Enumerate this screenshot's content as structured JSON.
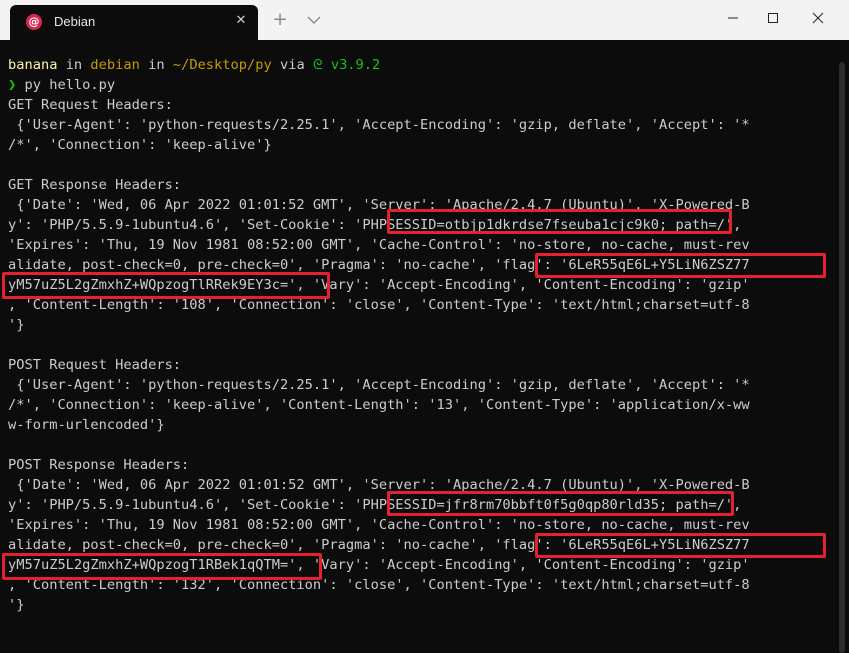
{
  "window": {
    "tab_title": "Debian",
    "tab_icon": "debian-swirl-icon",
    "close_tab": "✕",
    "new_tab": "+",
    "minimize": "—",
    "maximize": "☐",
    "close": "✕"
  },
  "colors": {
    "highlight": "#e3212f",
    "prompt_user": "#f9f1a5",
    "prompt_dir": "#c19c00",
    "prompt_py": "#16c60c"
  },
  "prompt": {
    "user": "banana",
    "in1": " in ",
    "host": "debian",
    "in2": " in ",
    "path": "~/Desktop/py",
    "via": " via ",
    "py_icon": "python-snake-icon",
    "version": "v3.9.2",
    "arrow": "❯",
    "command": " py hello.py"
  },
  "output": [
    "GET Request Headers:",
    " {'User-Agent': 'python-requests/2.25.1', 'Accept-Encoding': 'gzip, deflate', 'Accept': '*",
    "/*', 'Connection': 'keep-alive'}",
    "",
    "GET Response Headers:",
    " {'Date': 'Wed, 06 Apr 2022 01:01:52 GMT', 'Server': 'Apache/2.4.7 (Ubuntu)', 'X-Powered-B",
    "y': 'PHP/5.5.9-1ubuntu4.6', 'Set-Cookie': 'PHPSESSID=otbjp1dkrdse7fseuba1cjc9k0; path=/',",
    "'Expires': 'Thu, 19 Nov 1981 08:52:00 GMT', 'Cache-Control': 'no-store, no-cache, must-rev",
    "alidate, post-check=0, pre-check=0', 'Pragma': 'no-cache', 'flag': '6LeR55qE6L+Y5LiN6ZSZ77",
    "yM57uZ5L2gZmxhZ+WQpzogTlRRek9EY3c=', 'Vary': 'Accept-Encoding', 'Content-Encoding': 'gzip'",
    ", 'Content-Length': '108', 'Connection': 'close', 'Content-Type': 'text/html;charset=utf-8",
    "'}",
    "",
    "POST Request Headers:",
    " {'User-Agent': 'python-requests/2.25.1', 'Accept-Encoding': 'gzip, deflate', 'Accept': '*",
    "/*', 'Connection': 'keep-alive', 'Content-Length': '13', 'Content-Type': 'application/x-ww",
    "w-form-urlencoded'}",
    "",
    "POST Response Headers:",
    " {'Date': 'Wed, 06 Apr 2022 01:01:52 GMT', 'Server': 'Apache/2.4.7 (Ubuntu)', 'X-Powered-B",
    "y': 'PHP/5.5.9-1ubuntu4.6', 'Set-Cookie': 'PHPSESSID=jfr8rm70bbft0f5g0qp80rld35; path=/',",
    "'Expires': 'Thu, 19 Nov 1981 08:52:00 GMT', 'Cache-Control': 'no-store, no-cache, must-rev",
    "alidate, post-check=0, pre-check=0', 'Pragma': 'no-cache', 'flag': '6LeR55qE6L+Y5LiN6ZSZ77",
    "yM57uZ5L2gZmxhZ+WQpzogT1RBek1qQTM=', 'Vary': 'Accept-Encoding', 'Content-Encoding': 'gzip'",
    ", 'Content-Length': '132', 'Connection': 'close', 'Content-Type': 'text/html;charset=utf-8",
    "'}"
  ]
}
